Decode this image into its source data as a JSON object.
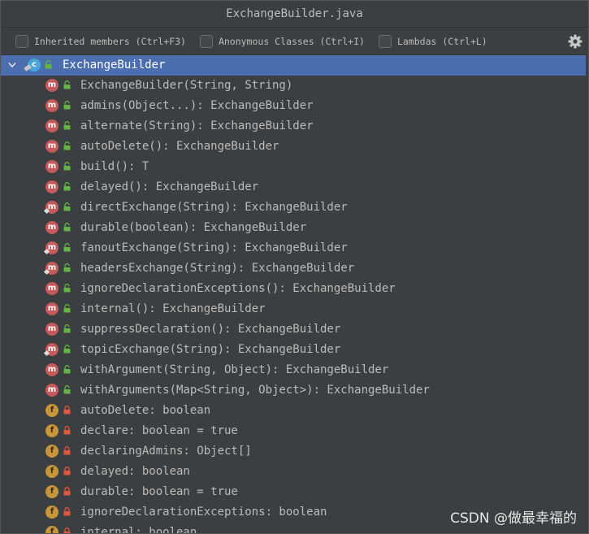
{
  "window": {
    "title": "ExchangeBuilder.java"
  },
  "toolbar": {
    "options": [
      {
        "label": "Inherited members (Ctrl+F3)",
        "checked": false
      },
      {
        "label": "Anonymous Classes (Ctrl+I)",
        "checked": false
      },
      {
        "label": "Lambdas (Ctrl+L)",
        "checked": false
      }
    ],
    "settings_icon": "gear-icon"
  },
  "tree": {
    "root": {
      "label": "ExchangeBuilder",
      "icon": "class-icon",
      "access": "public",
      "expanded": true
    },
    "members": [
      {
        "kind": "m",
        "access": "public",
        "overlay": false,
        "label": "ExchangeBuilder(String, String)"
      },
      {
        "kind": "m",
        "access": "public",
        "overlay": false,
        "label": "admins(Object...): ExchangeBuilder"
      },
      {
        "kind": "m",
        "access": "public",
        "overlay": false,
        "label": "alternate(String): ExchangeBuilder"
      },
      {
        "kind": "m",
        "access": "public",
        "overlay": false,
        "label": "autoDelete(): ExchangeBuilder"
      },
      {
        "kind": "m",
        "access": "public",
        "overlay": false,
        "label": "build(): T"
      },
      {
        "kind": "m",
        "access": "public",
        "overlay": false,
        "label": "delayed(): ExchangeBuilder"
      },
      {
        "kind": "m",
        "access": "public",
        "overlay": true,
        "label": "directExchange(String): ExchangeBuilder"
      },
      {
        "kind": "m",
        "access": "public",
        "overlay": false,
        "label": "durable(boolean): ExchangeBuilder"
      },
      {
        "kind": "m",
        "access": "public",
        "overlay": true,
        "label": "fanoutExchange(String): ExchangeBuilder"
      },
      {
        "kind": "m",
        "access": "public",
        "overlay": true,
        "label": "headersExchange(String): ExchangeBuilder"
      },
      {
        "kind": "m",
        "access": "public",
        "overlay": false,
        "label": "ignoreDeclarationExceptions(): ExchangeBuilder"
      },
      {
        "kind": "m",
        "access": "public",
        "overlay": false,
        "label": "internal(): ExchangeBuilder"
      },
      {
        "kind": "m",
        "access": "public",
        "overlay": false,
        "label": "suppressDeclaration(): ExchangeBuilder"
      },
      {
        "kind": "m",
        "access": "public",
        "overlay": true,
        "label": "topicExchange(String): ExchangeBuilder"
      },
      {
        "kind": "m",
        "access": "public",
        "overlay": false,
        "label": "withArgument(String, Object): ExchangeBuilder"
      },
      {
        "kind": "m",
        "access": "public",
        "overlay": false,
        "label": "withArguments(Map<String, Object>): ExchangeBuilder"
      },
      {
        "kind": "f",
        "access": "private",
        "overlay": false,
        "label": "autoDelete: boolean"
      },
      {
        "kind": "f",
        "access": "private",
        "overlay": false,
        "label": "declare: boolean = true"
      },
      {
        "kind": "f",
        "access": "private",
        "overlay": false,
        "label": "declaringAdmins: Object[]"
      },
      {
        "kind": "f",
        "access": "private",
        "overlay": false,
        "label": "delayed: boolean"
      },
      {
        "kind": "f",
        "access": "private",
        "overlay": false,
        "label": "durable: boolean = true"
      },
      {
        "kind": "f",
        "access": "private",
        "overlay": false,
        "label": "ignoreDeclarationExceptions: boolean"
      },
      {
        "kind": "f",
        "access": "private",
        "overlay": false,
        "label": "internal: boolean"
      }
    ]
  },
  "watermark": "CSDN @做最幸福的",
  "colors": {
    "background": "#3c3f41",
    "selection": "#4b6eaf",
    "method_badge": "#c65a5a",
    "field_badge": "#c7963b",
    "public_lock": "#62b543",
    "private_lock": "#e0573e",
    "class_badge": "#49a4d8"
  }
}
